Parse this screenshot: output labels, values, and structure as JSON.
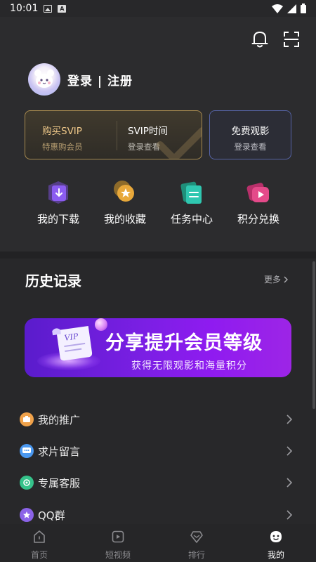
{
  "status_bar": {
    "time": "10:01",
    "icons": [
      "image-icon",
      "a-icon"
    ],
    "right_icons": [
      "wifi-icon",
      "signal-icon",
      "battery-icon"
    ]
  },
  "header": {
    "actions": [
      "bell-icon",
      "scan-icon"
    ]
  },
  "user": {
    "login_label": "登录 | 注册"
  },
  "vip_card": {
    "buy": {
      "title": "购买SVIP",
      "subtitle": "特惠购会员"
    },
    "time": {
      "title": "SVIP时间",
      "subtitle": "登录查看"
    }
  },
  "free_card": {
    "title": "免费观影",
    "subtitle": "登录查看"
  },
  "quick_actions": [
    {
      "label": "我的下载",
      "icon": "download-icon"
    },
    {
      "label": "我的收藏",
      "icon": "star-icon"
    },
    {
      "label": "任务中心",
      "icon": "task-icon"
    },
    {
      "label": "积分兑换",
      "icon": "exchange-icon"
    }
  ],
  "history": {
    "title": "历史记录",
    "more": "更多"
  },
  "banner": {
    "title": "分享提升会员等级",
    "subtitle": "获得无限观影和海量积分",
    "paper_text": "VIP"
  },
  "menu": [
    {
      "label": "我的推广",
      "icon": "promote-icon",
      "color": "#f0a24a"
    },
    {
      "label": "求片留言",
      "icon": "message-icon",
      "color": "#4a98f0"
    },
    {
      "label": "专属客服",
      "icon": "service-icon",
      "color": "#35c28a"
    },
    {
      "label": "QQ群",
      "icon": "qq-group-icon",
      "color": "#8b63e8"
    }
  ],
  "tabbar": [
    {
      "label": "首页",
      "icon": "home-icon",
      "active": false
    },
    {
      "label": "短视频",
      "icon": "short-video-icon",
      "active": false
    },
    {
      "label": "排行",
      "icon": "ranking-icon",
      "active": false
    },
    {
      "label": "我的",
      "icon": "profile-icon",
      "active": true
    }
  ],
  "colors": {
    "background": "#28282a",
    "gold": "#f0c98a",
    "purple": "#7b1fe4",
    "free_border": "#5563a6"
  }
}
